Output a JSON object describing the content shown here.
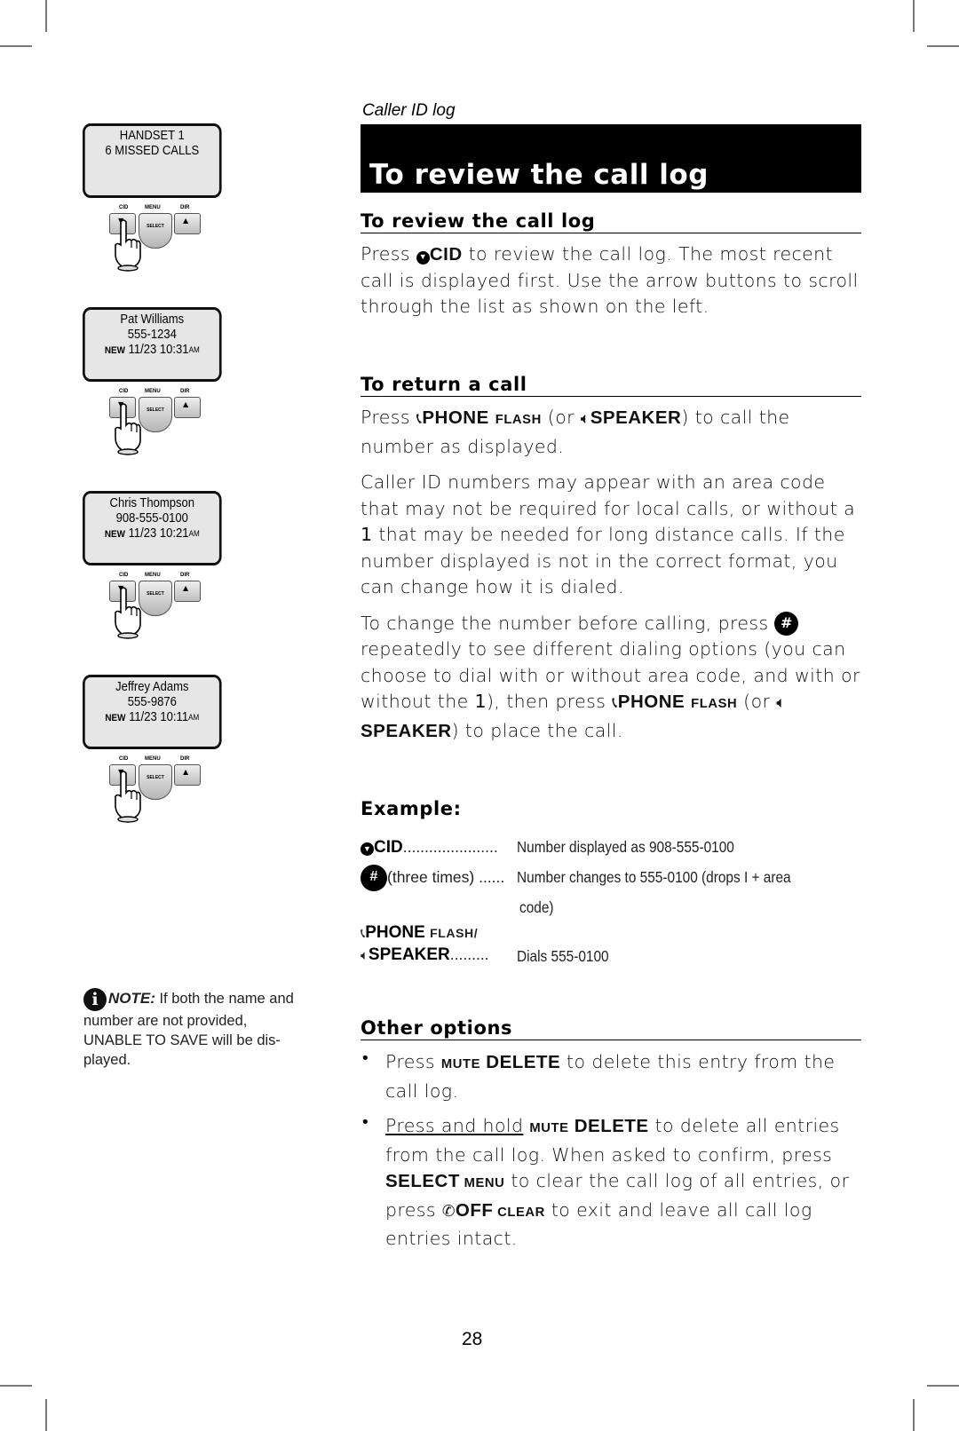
{
  "section_label": "Caller ID log",
  "page_title": "To review the call log",
  "screens": [
    {
      "line1": "HANDSET 1",
      "line2": "6 MISSED CALLS",
      "new_tag": "",
      "date_time": "",
      "ampm": ""
    },
    {
      "line1": "Pat Williams",
      "line2": "555-1234",
      "new_tag": "NEW",
      "date_time": "11/23 10:31",
      "ampm": "AM"
    },
    {
      "line1": "Chris Thompson",
      "line2": "908-555-0100",
      "new_tag": "NEW",
      "date_time": "11/23 10:21",
      "ampm": "AM"
    },
    {
      "line1": "Jeffrey Adams",
      "line2": "555-9876",
      "new_tag": "NEW",
      "date_time": "11/23 10:11",
      "ampm": "AM"
    }
  ],
  "keypad": {
    "cid_label": "CID",
    "menu_label": "MENU",
    "dir_label": "DIR",
    "select_label": "SELECT",
    "down_arrow": "▼",
    "up_arrow": "▲"
  },
  "note": {
    "label": "NOTE:",
    "icon": "i",
    "text": " If both the name and number are not provided, UNABLE TO SAVE will be dis-played."
  },
  "sections": {
    "review": {
      "heading": "To review the call log",
      "p1_a": "Press ",
      "p1_key": "CID",
      "p1_b": " to review the call log.  The most recent call is displayed first. Use the arrow buttons to scroll through the list as shown on the left."
    },
    "return_call": {
      "heading": "To return a call",
      "p1_a": "Press ",
      "phone_key": "PHONE",
      "flash_key": "FLASH",
      "p1_b": " (or ",
      "speaker_key": "SPEAKER",
      "p1_c": ") to call the number as displayed.",
      "p2_a": "Caller ID numbers may appear with an area code that may not be required for local calls, or without a ",
      "p2_one": "1",
      "p2_b": " that may be needed for long distance calls. If the number displayed is not in the correct format, you can change how it is dialed.",
      "p3_a": "To change the number before calling, press ",
      "p3_hash": "#",
      "p3_b": " repeatedly to see different dialing options (you can choose to dial with or without area code, and with or without the ",
      "p3_one": "1",
      "p3_c": "), then press ",
      "p3_d": " (or ",
      "p3_e": ") to place the call."
    },
    "example": {
      "heading": "Example:",
      "rows": [
        {
          "key": "CID",
          "dots": "......................",
          "desc": "Number displayed as 908-555-0100"
        },
        {
          "key": "#",
          "suffix": "(three times) ",
          "dots": "......",
          "desc": "Number changes to 555-0100 (drops  I  + area",
          "desc2": "code)"
        },
        {
          "key_line1": "PHONE ",
          "key_line1_small": "FLASH/",
          "key": "SPEAKER",
          "dots": ".........",
          "desc": "Dials 555-0100"
        }
      ]
    },
    "other_options": {
      "heading": "Other options",
      "bullets": [
        {
          "a": "Press ",
          "mute": "MUTE",
          "delete": " DELETE",
          "b": " to delete this entry from the call log."
        },
        {
          "hold": "Press and hold",
          "mute": "MUTE",
          "delete": " DELETE",
          "b": " to delete all entries from the call log.  When asked to confirm, press ",
          "select": "SELECT",
          "menu": " MENU",
          "c": " to clear the call log of all entries, or press ",
          "off": "OFF",
          "clear": " CLEAR",
          "d": " to exit and leave all call log entries intact."
        }
      ]
    }
  },
  "page_number": "28"
}
